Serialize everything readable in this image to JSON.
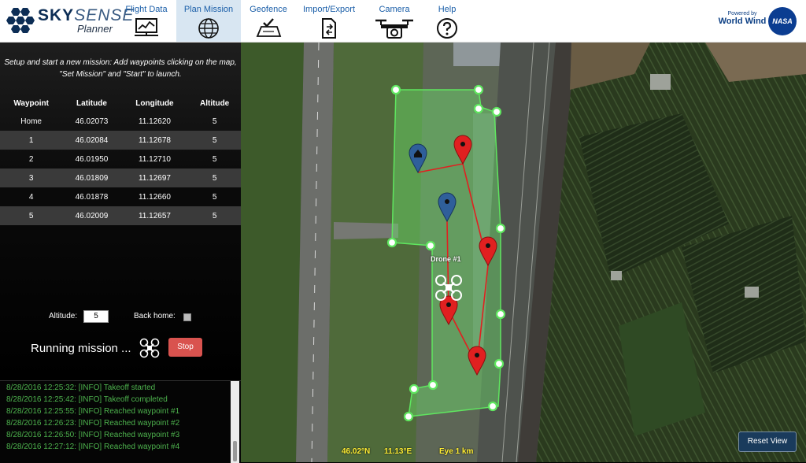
{
  "brand": {
    "name_bold": "SKY",
    "name_light": "SENSE",
    "sub": "Planner"
  },
  "nav": [
    {
      "label": "Flight Data",
      "icon": "chart-board-icon",
      "active": false
    },
    {
      "label": "Plan Mission",
      "icon": "globe-icon",
      "active": true
    },
    {
      "label": "Geofence",
      "icon": "map-check-icon",
      "active": false
    },
    {
      "label": "Import/Export",
      "icon": "file-transfer-icon",
      "active": false
    },
    {
      "label": "Camera",
      "icon": "drone-camera-icon",
      "active": false
    },
    {
      "label": "Help",
      "icon": "question-icon",
      "active": false
    }
  ],
  "powered": {
    "small": "Powered by",
    "big": "World Wind",
    "nasa": "NASA"
  },
  "mission": {
    "intro": "Setup and start a new mission: Add waypoints clicking on the map, \"Set Mission\" and \"Start\" to launch.",
    "headers": [
      "Waypoint",
      "Latitude",
      "Longitude",
      "Altitude"
    ],
    "rows": [
      [
        "Home",
        "46.02073",
        "11.12620",
        "5"
      ],
      [
        "1",
        "46.02084",
        "11.12678",
        "5"
      ],
      [
        "2",
        "46.01950",
        "11.12710",
        "5"
      ],
      [
        "3",
        "46.01809",
        "11.12697",
        "5"
      ],
      [
        "4",
        "46.01878",
        "11.12660",
        "5"
      ],
      [
        "5",
        "46.02009",
        "11.12657",
        "5"
      ]
    ],
    "altitude_label": "Altitude:",
    "altitude_value": "5",
    "back_home_label": "Back home:",
    "running_text": "Running mission ...",
    "stop_label": "Stop"
  },
  "log": [
    "8/28/2016 12:25:32: [INFO] Takeoff started",
    "8/28/2016 12:25:42: [INFO] Takeoff completed",
    "8/28/2016 12:25:55: [INFO] Reached waypoint #1",
    "8/28/2016 12:26:23: [INFO] Reached waypoint #2",
    "8/28/2016 12:26:50: [INFO] Reached waypoint #3",
    "8/28/2016 12:27:12: [INFO] Reached waypoint #4"
  ],
  "map": {
    "drone_label": "Drone #1",
    "lat": "46.02°N",
    "lon": "11.13°E",
    "eye": "Eye  1 km",
    "reset_label": "Reset View",
    "colors": {
      "geofence": "#5fe65f",
      "route": "#e02020",
      "marker_red": "#e02020",
      "marker_blue": "#2f5f9a"
    }
  }
}
